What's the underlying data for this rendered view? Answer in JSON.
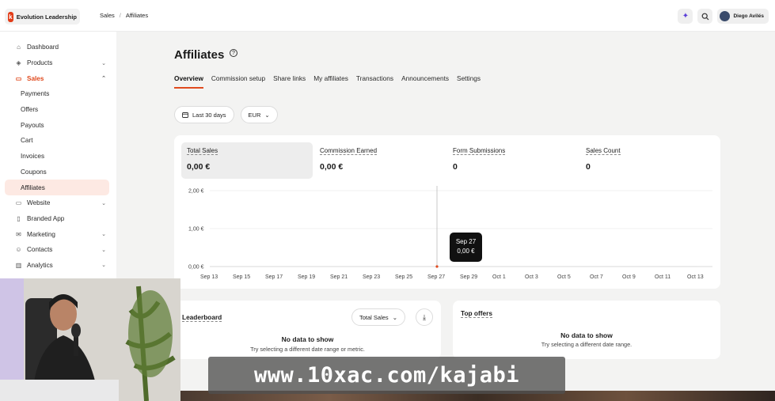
{
  "brand": {
    "logo_letter": "k",
    "name": "Evolution Leadership"
  },
  "breadcrumb": [
    "Sales",
    "Affiliates"
  ],
  "user": {
    "name": "Diego Avilés"
  },
  "sidebar": {
    "items": [
      {
        "label": "Dashboard",
        "icon": "home-icon"
      },
      {
        "label": "Products",
        "icon": "box-icon"
      },
      {
        "label": "Sales",
        "icon": "card-icon"
      },
      {
        "label": "Payments"
      },
      {
        "label": "Offers"
      },
      {
        "label": "Payouts"
      },
      {
        "label": "Cart"
      },
      {
        "label": "Invoices"
      },
      {
        "label": "Coupons"
      },
      {
        "label": "Affiliates"
      },
      {
        "label": "Website",
        "icon": "monitor-icon"
      },
      {
        "label": "Branded App",
        "icon": "phone-icon"
      },
      {
        "label": "Marketing",
        "icon": "mail-icon"
      },
      {
        "label": "Contacts",
        "icon": "people-icon"
      },
      {
        "label": "Analytics",
        "icon": "chart-icon"
      }
    ]
  },
  "page": {
    "title": "Affiliates",
    "tabs": [
      "Overview",
      "Commission setup",
      "Share links",
      "My affiliates",
      "Transactions",
      "Announcements",
      "Settings"
    ],
    "active_tab": "Overview"
  },
  "filters": {
    "date_range": "Last 30 days",
    "currency": "EUR"
  },
  "metrics": [
    {
      "label": "Total Sales",
      "value": "0,00 €"
    },
    {
      "label": "Commission Earned",
      "value": "0,00 €"
    },
    {
      "label": "Form Submissions",
      "value": "0"
    },
    {
      "label": "Sales Count",
      "value": "0"
    }
  ],
  "chart_data": {
    "type": "line",
    "x": [
      "Sep 13",
      "Sep 15",
      "Sep 17",
      "Sep 19",
      "Sep 21",
      "Sep 23",
      "Sep 25",
      "Sep 27",
      "Sep 29",
      "Oct 1",
      "Oct 3",
      "Oct 5",
      "Oct 7",
      "Oct 9",
      "Oct 11",
      "Oct 13"
    ],
    "series": [
      {
        "values": [
          0,
          0,
          0,
          0,
          0,
          0,
          0,
          0,
          0,
          0,
          0,
          0,
          0,
          0,
          0,
          0
        ]
      }
    ],
    "y_ticks": [
      "2,00 €",
      "1,00 €",
      "0,00 €"
    ],
    "ylim": [
      0,
      2
    ],
    "grid": true,
    "tooltip": {
      "date": "Sep 27",
      "value": "0,00 €"
    }
  },
  "leaderboard": {
    "title": "Leaderboard",
    "select_value": "Total Sales",
    "empty_title": "No data to show",
    "empty_sub": "Try selecting a different date range or metric."
  },
  "top_offers": {
    "title": "Top offers",
    "empty_title": "No data to show",
    "empty_sub": "Try selecting a different date range."
  },
  "overlay": {
    "banner_text": "www.10xac.com/kajabi"
  },
  "colors": {
    "accent": "#e04a1e",
    "tool_icon": "#5b3fd8"
  }
}
